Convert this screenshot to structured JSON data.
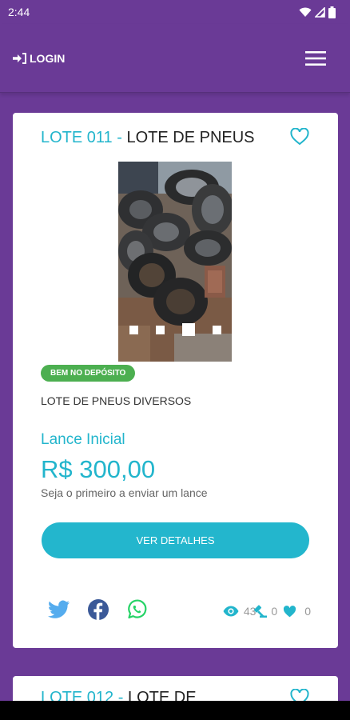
{
  "status_bar": {
    "time": "2:44",
    "icons": [
      "wifi-icon",
      "signal-icon",
      "battery-icon"
    ]
  },
  "header": {
    "login_label": "LOGIN",
    "login_icon": "sign-in-icon",
    "menu_icon": "hamburger-menu-icon"
  },
  "lot": {
    "number": "LOTE 011",
    "separator": " - ",
    "name": "LOTE DE PNEUS",
    "favorite_icon": "heart-outline-icon",
    "photo_icon": "tires-photo",
    "carousel": {
      "count": 4,
      "active_index": 2
    },
    "badge": "BEM NO DEPÓSITO",
    "description": "LOTE DE PNEUS DIVERSOS",
    "bid_label": "Lance Inicial",
    "bid_value": "R$ 300,00",
    "bid_hint": "Seja o primeiro a enviar um lance",
    "details_button": "VER DETALHES",
    "share_icons": [
      "twitter-icon",
      "facebook-icon",
      "whatsapp-icon"
    ],
    "stats": {
      "views": "43",
      "bids": "0",
      "likes": "0"
    }
  },
  "next_lot": {
    "number": "LOTE 012",
    "separator": " - ",
    "name": "LOTE DE"
  },
  "colors": {
    "background": "#6a3a96",
    "accent": "#22b5cc",
    "badge": "#4caf50",
    "twitter": "#55acee",
    "facebook": "#3b5998",
    "whatsapp": "#25d366"
  }
}
